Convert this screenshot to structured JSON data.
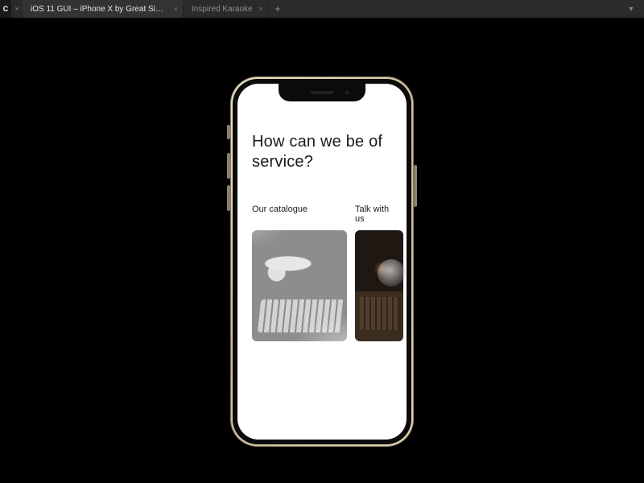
{
  "tabbar": {
    "left_cap": "C",
    "tabs": [
      {
        "label": "iOS 11 GUI – iPhone X by Great Simp...",
        "active": true
      },
      {
        "label": "Inspired Karaoke",
        "active": false
      }
    ]
  },
  "app": {
    "heading": "How can we be of service?",
    "cards": [
      {
        "label": "Our catalogue"
      },
      {
        "label": "Talk with us"
      }
    ]
  }
}
